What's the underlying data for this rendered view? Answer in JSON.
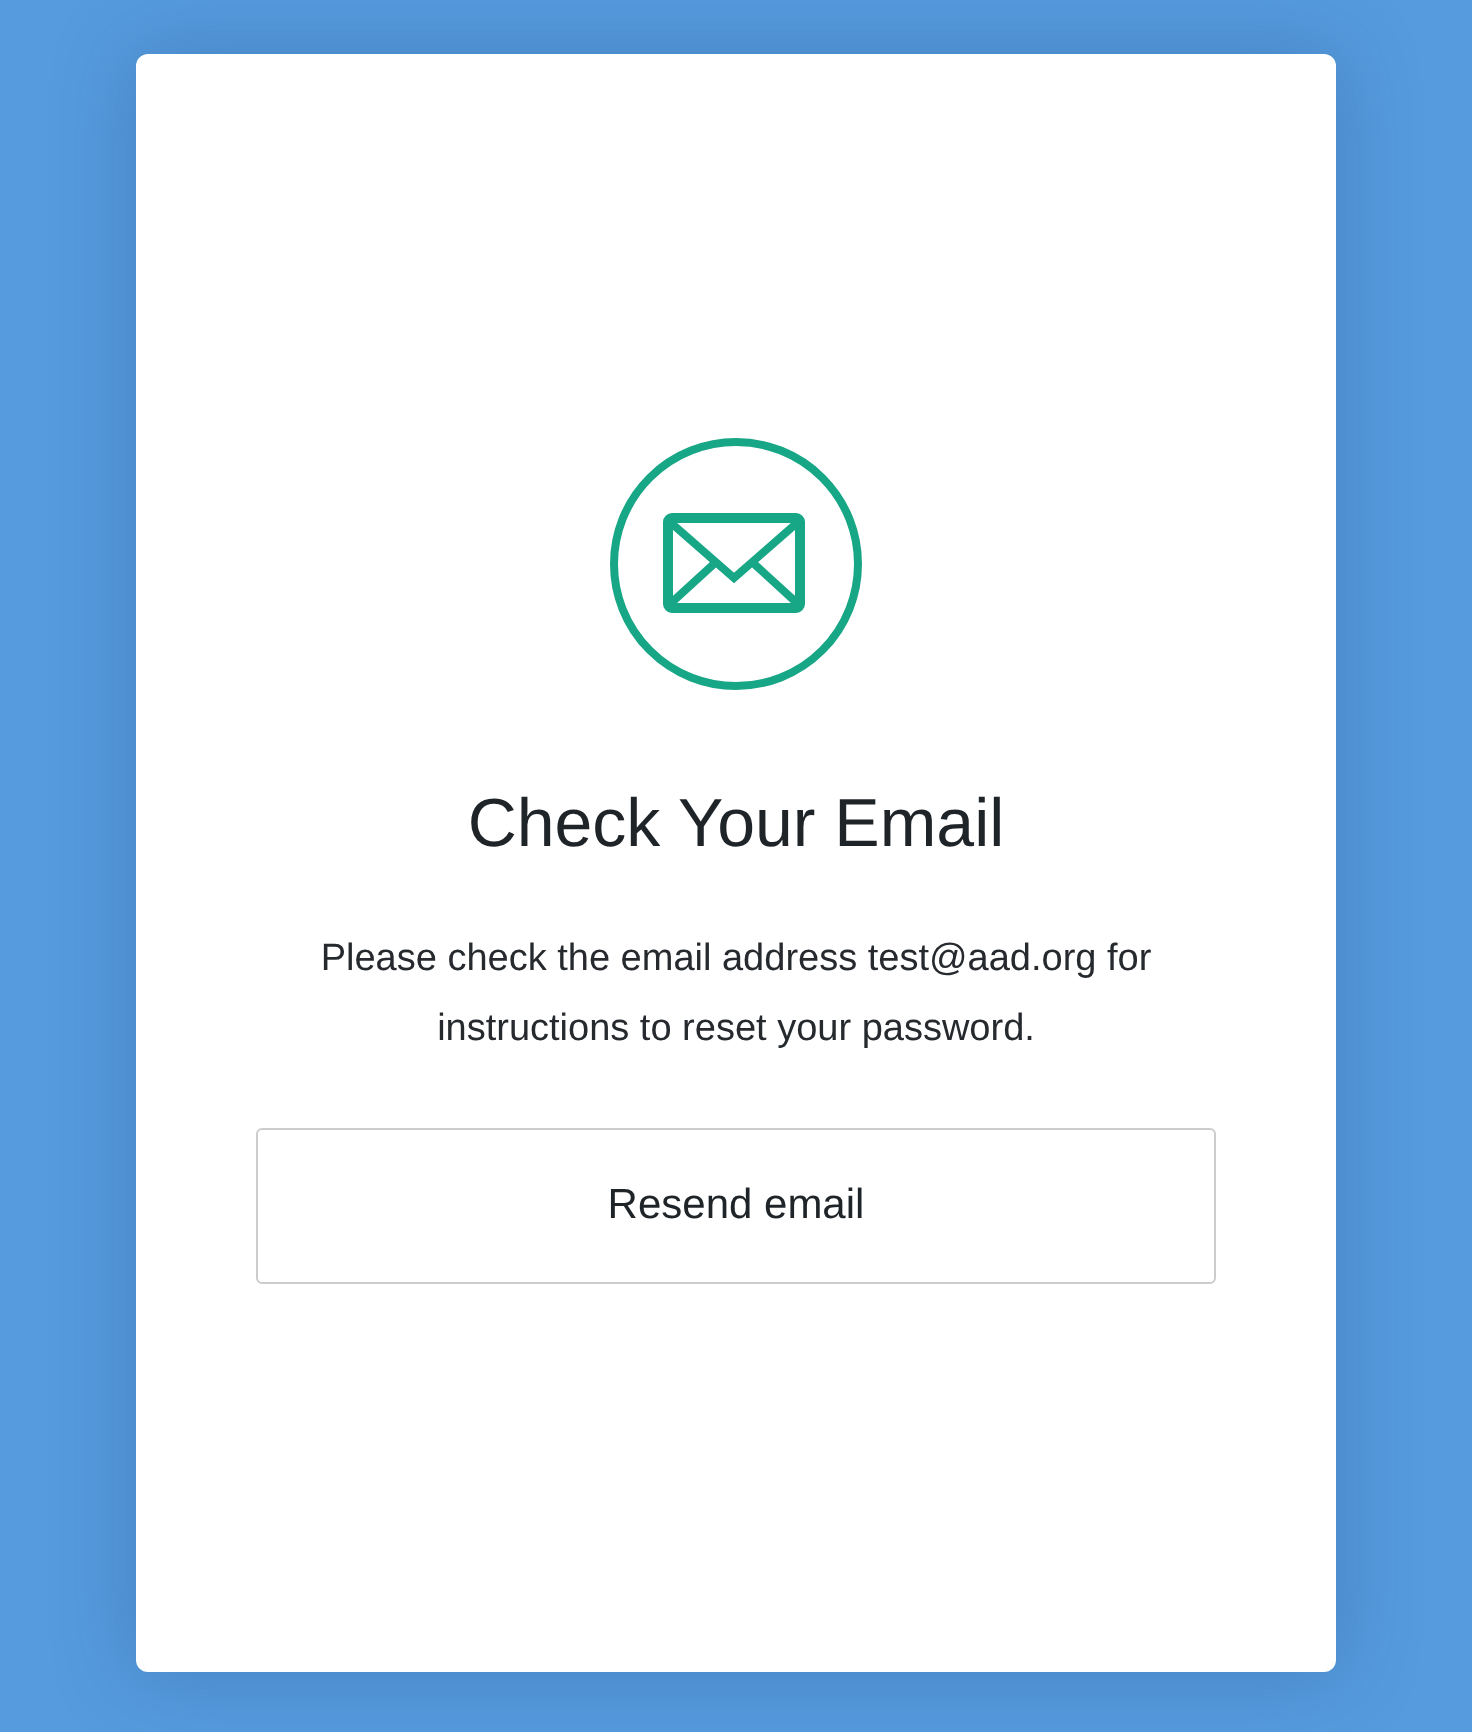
{
  "card": {
    "title": "Check Your Email",
    "message": "Please check the email address test@aad.org for instructions to reset your password.",
    "button": "Resend email"
  }
}
